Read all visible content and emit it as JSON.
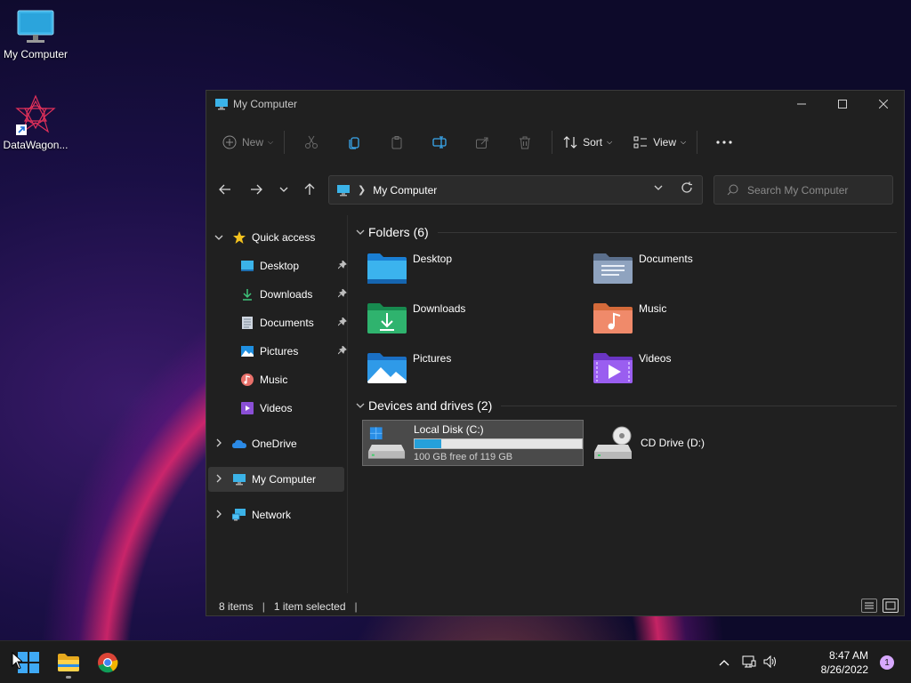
{
  "desktop": {
    "icons": [
      {
        "label": "My Computer",
        "icon": "monitor-icon"
      },
      {
        "label": "DataWagon...",
        "icon": "datawagon-shortcut-icon"
      }
    ]
  },
  "window": {
    "title": "My Computer",
    "controls": {
      "minimize": "minimize-icon",
      "maximize": "maximize-icon",
      "close": "close-icon"
    }
  },
  "toolbar": {
    "new_label": "New",
    "sort_label": "Sort",
    "view_label": "View",
    "icons": [
      "cut-icon",
      "copy-icon",
      "paste-icon",
      "rename-icon",
      "share-icon",
      "delete-icon",
      "more-icon"
    ]
  },
  "address": {
    "location": "My Computer",
    "search_placeholder": "Search My Computer"
  },
  "sidebar": {
    "quick_access": "Quick access",
    "items": [
      {
        "label": "Desktop",
        "pinned": true
      },
      {
        "label": "Downloads",
        "pinned": true
      },
      {
        "label": "Documents",
        "pinned": true
      },
      {
        "label": "Pictures",
        "pinned": true
      },
      {
        "label": "Music",
        "pinned": false
      },
      {
        "label": "Videos",
        "pinned": false
      }
    ],
    "onedrive": "OneDrive",
    "mycomputer": "My Computer",
    "network": "Network"
  },
  "content": {
    "folders_heading": "Folders (6)",
    "folders": [
      {
        "label": "Desktop"
      },
      {
        "label": "Documents"
      },
      {
        "label": "Downloads"
      },
      {
        "label": "Music"
      },
      {
        "label": "Pictures"
      },
      {
        "label": "Videos"
      }
    ],
    "drives_heading": "Devices and drives (2)",
    "drives": [
      {
        "label": "Local Disk (C:)",
        "free": "100 GB free of 119 GB",
        "used_fraction": 0.16
      },
      {
        "label": "CD Drive (D:)"
      }
    ]
  },
  "status": {
    "items": "8 items",
    "selected": "1 item selected"
  },
  "taskbar": {
    "time": "8:47 AM",
    "date": "8/26/2022",
    "notifications": "1"
  },
  "colors": {
    "accent": "#26a0da",
    "window_bg": "#202020",
    "taskbar_bg": "#1c1c1c"
  }
}
